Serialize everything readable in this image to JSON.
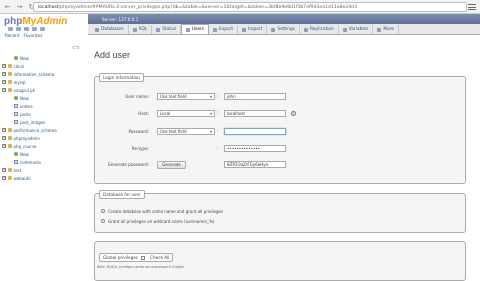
{
  "browser": {
    "url_scheme": "localhost",
    "url_path": "/phpmyadmin/#PMAURL-2:server_privileges.php?db=&table=&server=1&target=&token=3bf8b9e8d1f3b7ef9d3ea1d11a8e24d3",
    "back": "←",
    "forward": "→",
    "reload": "↻"
  },
  "sidebar": {
    "logo_php": "php",
    "logo_my": "My",
    "logo_admin": "Admin",
    "tab_recent": "Recent",
    "tab_favorites": "Favorites",
    "tools": "⊂⊃",
    "tree": [
      {
        "label": "New",
        "kind": "new",
        "indent": 1
      },
      {
        "label": "cdcol",
        "kind": "db",
        "indent": 0
      },
      {
        "label": "information_schema",
        "kind": "db",
        "indent": 0
      },
      {
        "label": "mysql",
        "kind": "db",
        "indent": 0
      },
      {
        "label": "naagrul pk",
        "kind": "db",
        "indent": 0
      },
      {
        "label": "New",
        "kind": "new",
        "indent": 1
      },
      {
        "label": "orders",
        "kind": "table",
        "indent": 1
      },
      {
        "label": "posts",
        "kind": "table",
        "indent": 1
      },
      {
        "label": "post_images",
        "kind": "table",
        "indent": 1
      },
      {
        "label": "performance_schema",
        "kind": "db",
        "indent": 0
      },
      {
        "label": "phpmyadmin",
        "kind": "db",
        "indent": 0
      },
      {
        "label": "php_course",
        "kind": "db",
        "indent": 0
      },
      {
        "label": "New",
        "kind": "new",
        "indent": 1
      },
      {
        "label": "comments",
        "kind": "table",
        "indent": 1
      },
      {
        "label": "test",
        "kind": "db",
        "indent": 0
      },
      {
        "label": "webauth",
        "kind": "db",
        "indent": 0
      }
    ]
  },
  "server_bar": "Server: 127.0.0.1",
  "tabs": [
    {
      "label": "Databases",
      "active": false
    },
    {
      "label": "SQL",
      "active": false
    },
    {
      "label": "Status",
      "active": false
    },
    {
      "label": "Users",
      "active": true
    },
    {
      "label": "Export",
      "active": false
    },
    {
      "label": "Import",
      "active": false
    },
    {
      "label": "Settings",
      "active": false
    },
    {
      "label": "Replication",
      "active": false
    },
    {
      "label": "Variables",
      "active": false
    },
    {
      "label": "More",
      "active": false
    }
  ],
  "page_title": "Add user",
  "login": {
    "legend": "Login Information",
    "user_name_label": "User name:",
    "user_name_mode": "Use text field",
    "user_name_value": "john",
    "host_label": "Host:",
    "host_mode": "Local",
    "host_value": "localhost",
    "password_label": "Password:",
    "password_mode": "Use text field",
    "password_value": "",
    "retype_label": "Re-type:",
    "retype_value": "••••••••••••••",
    "generate_label": "Generate password:",
    "generate_button": "Generate",
    "generated_value": "BZP2OaZrFGy6eHyo",
    "colon": ":"
  },
  "database": {
    "legend": "Database for user",
    "option1": "Create database with same name and grant all privileges",
    "option2": "Grant all privileges on wildcard name (username\\_%)"
  },
  "global": {
    "legend": "Global privileges",
    "check_all": "Check All"
  },
  "note": "Note: MySQL privilege names are expressed in English"
}
